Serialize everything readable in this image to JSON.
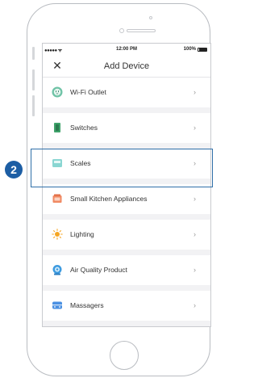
{
  "status_bar": {
    "signal": "●●●●● ᯤ",
    "time": "12:00 PM",
    "battery_pct": "100%"
  },
  "header": {
    "close_symbol": "✕",
    "title": "Add Device"
  },
  "categories": [
    {
      "label": "Wi-Fi Outlet",
      "icon": "outlet-icon"
    },
    {
      "label": "Switches",
      "icon": "switch-icon"
    },
    {
      "label": "Scales",
      "icon": "scale-icon"
    },
    {
      "label": "Small Kitchen Appliances",
      "icon": "kitchen-appliance-icon"
    },
    {
      "label": "Lighting",
      "icon": "light-icon"
    },
    {
      "label": "Air Quality Product",
      "icon": "air-quality-icon"
    },
    {
      "label": "Massagers",
      "icon": "massager-icon"
    }
  ],
  "chevron": "›",
  "step": {
    "number": "2",
    "highlighted_item": "Scales"
  },
  "colors": {
    "accent": "#1d5ea4",
    "highlight_border": "#2f6fa8",
    "screen_bg": "#f2f2f4",
    "outlet": "#6fc3a6",
    "switch": "#3fa36b",
    "scale": "#8ad6d2",
    "kitchen": "#f08a63",
    "lighting": "#f5a623",
    "air": "#3d9be0",
    "massager": "#4a90e2"
  }
}
